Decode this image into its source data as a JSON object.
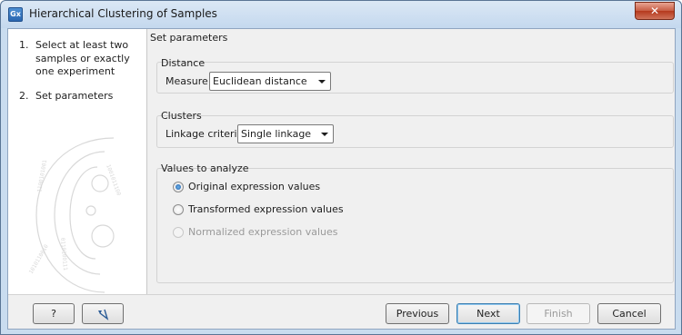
{
  "window": {
    "title": "Hierarchical Clustering of Samples",
    "app_icon_text": "Gx",
    "close_icon": "✕"
  },
  "steps": [
    {
      "number": "1.",
      "label": "Select at least two samples or exactly one experiment"
    },
    {
      "number": "2.",
      "label": "Set parameters"
    }
  ],
  "main": {
    "heading": "Set parameters",
    "distance": {
      "title": "Distance",
      "measure_label": "Measure",
      "measure_value": "Euclidean distance"
    },
    "clusters": {
      "title": "Clusters",
      "linkage_label": "Linkage criteria",
      "linkage_value": "Single linkage"
    },
    "values": {
      "title": "Values to analyze",
      "options": [
        {
          "label": "Original expression values",
          "selected": true,
          "enabled": true
        },
        {
          "label": "Transformed expression values",
          "selected": false,
          "enabled": true
        },
        {
          "label": "Normalized expression values",
          "selected": false,
          "enabled": false
        }
      ]
    }
  },
  "footer": {
    "help_label": "?",
    "reset_icon": "reset-arrow-icon",
    "previous_label": "Previous",
    "next_label": "Next",
    "finish_label": "Finish",
    "cancel_label": "Cancel"
  }
}
